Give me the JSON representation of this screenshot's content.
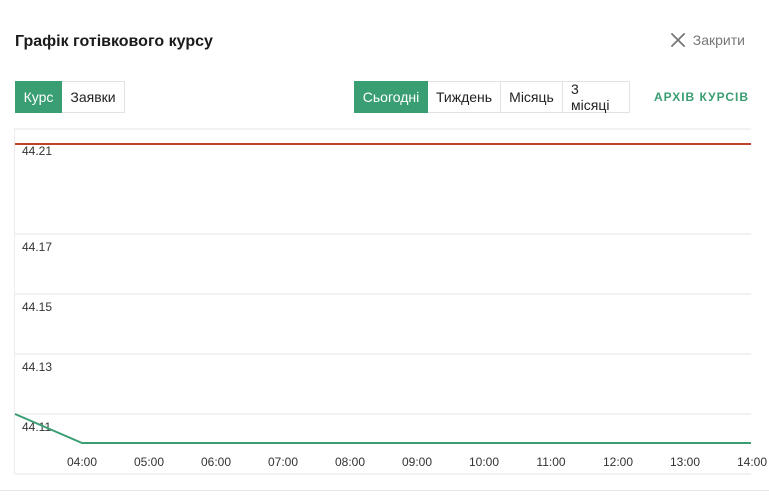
{
  "header": {
    "title": "Графік готівкового курсу",
    "close_label": "Закрити"
  },
  "mode_tabs": [
    {
      "label": "Курс",
      "active": true
    },
    {
      "label": "Заявки",
      "active": false
    }
  ],
  "period_tabs": [
    {
      "label": "Сьогодні",
      "active": true
    },
    {
      "label": "Тиждень",
      "active": false
    },
    {
      "label": "Місяць",
      "active": false
    },
    {
      "label": "3 місяці",
      "active": false
    }
  ],
  "archive_label": "АРХІВ КУРСІВ",
  "colors": {
    "accent": "#3a9e73",
    "sell_line": "#c0412b",
    "buy_line": "#3a9e73",
    "grid": "#e6e6e6"
  },
  "chart_data": {
    "type": "line",
    "x_ticks": [
      "04:00",
      "05:00",
      "06:00",
      "07:00",
      "08:00",
      "09:00",
      "10:00",
      "11:00",
      "12:00",
      "13:00",
      "14:00"
    ],
    "y_ticks": [
      "44.21",
      "44.17",
      "44.15",
      "44.13",
      "44.11"
    ],
    "grid": true,
    "series": [
      {
        "color": "#c0412b",
        "points": [
          [
            "03:00",
            44.21
          ],
          [
            "14:30",
            44.21
          ]
        ]
      },
      {
        "color": "#3a9e73",
        "points": [
          [
            "03:00",
            44.11
          ],
          [
            "04:00",
            44.1
          ],
          [
            "14:30",
            44.1
          ]
        ]
      }
    ]
  }
}
